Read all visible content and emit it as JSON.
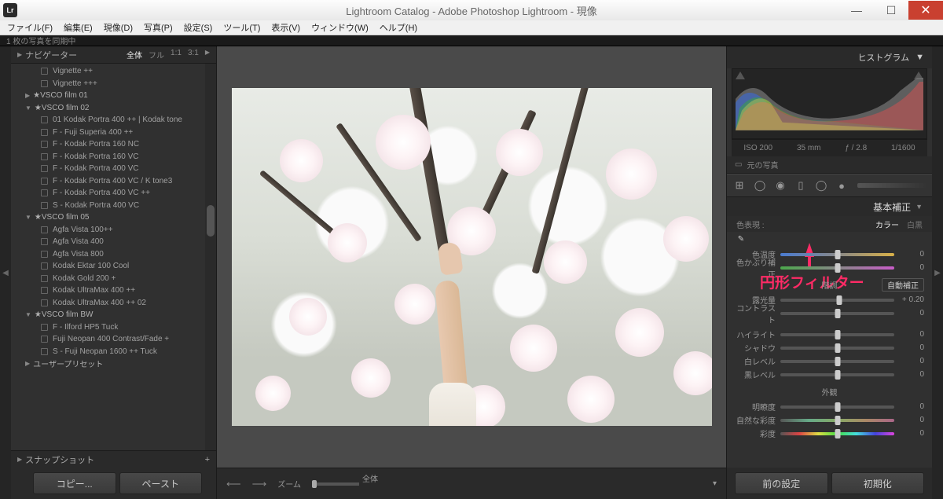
{
  "window": {
    "title": "Lightroom Catalog - Adobe Photoshop Lightroom - 現像",
    "icon_text": "Lr"
  },
  "menu": [
    "ファイル(F)",
    "編集(E)",
    "現像(D)",
    "写真(P)",
    "設定(S)",
    "ツール(T)",
    "表示(V)",
    "ウィンドウ(W)",
    "ヘルプ(H)"
  ],
  "sync_status": "1 枚の写真を同期中",
  "navigator": {
    "title": "ナビゲーター",
    "options": [
      "全体",
      "フル",
      "1:1",
      "3:1"
    ],
    "active": "全体"
  },
  "presets": [
    {
      "type": "child",
      "label": "Vignette ++"
    },
    {
      "type": "child",
      "label": "Vignette +++"
    },
    {
      "type": "folder",
      "label": "★VSCO film 01"
    },
    {
      "type": "folder",
      "label": "★VSCO film 02",
      "open": true
    },
    {
      "type": "child",
      "label": "01 Kodak Portra 400 ++ | Kodak tone"
    },
    {
      "type": "child",
      "label": "F - Fuji Superia 400 ++"
    },
    {
      "type": "child",
      "label": "F - Kodak Portra 160 NC"
    },
    {
      "type": "child",
      "label": "F - Kodak Portra 160 VC"
    },
    {
      "type": "child",
      "label": "F - Kodak Portra 400 VC"
    },
    {
      "type": "child",
      "label": "F - Kodak Portra 400 VC / K tone3"
    },
    {
      "type": "child",
      "label": "F - Kodak Portra 400 VC ++"
    },
    {
      "type": "child",
      "label": "S - Kodak Portra 400 VC"
    },
    {
      "type": "folder",
      "label": "★VSCO film 05",
      "open": true
    },
    {
      "type": "child",
      "label": "Agfa Vista 100++"
    },
    {
      "type": "child",
      "label": "Agfa Vista 400"
    },
    {
      "type": "child",
      "label": "Agfa Vista 800"
    },
    {
      "type": "child",
      "label": "Kodak Ektar 100 Cool"
    },
    {
      "type": "child",
      "label": "Kodak Gold 200 +"
    },
    {
      "type": "child",
      "label": "Kodak UltraMax 400 ++"
    },
    {
      "type": "child",
      "label": "Kodak UltraMax 400 ++ 02"
    },
    {
      "type": "folder",
      "label": "★VSCO film BW",
      "open": true
    },
    {
      "type": "child",
      "label": "F - Ilford HP5 Tuck"
    },
    {
      "type": "child",
      "label": "Fuji Neopan 400 Contrast/Fade +"
    },
    {
      "type": "child",
      "label": "S - Fuji Neopan 1600 ++ Tuck"
    },
    {
      "type": "folder",
      "label": "ユーザープリセット"
    }
  ],
  "snapshot": "スナップショット",
  "left_buttons": {
    "copy": "コピー...",
    "paste": "ペースト"
  },
  "center": {
    "zoom_label": "ズーム",
    "zoom_value": "全体"
  },
  "right": {
    "histogram_title": "ヒストグラム",
    "exif": {
      "iso": "ISO 200",
      "focal": "35 mm",
      "aperture": "ƒ / 2.8",
      "shutter": "1/1600"
    },
    "original": "元の写真",
    "basic_title": "基本補正",
    "treatment_label": "色表現 :",
    "treatment_color": "カラー",
    "treatment_bw": "白黒",
    "annotation": "円形フィルター",
    "tone_header": "階調",
    "auto_tone": "自動補正",
    "presence_header": "外観",
    "sliders": {
      "temp": {
        "label": "色温度",
        "value": "0",
        "pos": 50
      },
      "tint": {
        "label": "色かぶり補正",
        "value": "0",
        "pos": 50
      },
      "exposure": {
        "label": "露光量",
        "value": "+ 0.20",
        "pos": 52
      },
      "contrast": {
        "label": "コントラスト",
        "value": "0",
        "pos": 50
      },
      "highlights": {
        "label": "ハイライト",
        "value": "0",
        "pos": 50
      },
      "shadows": {
        "label": "シャドウ",
        "value": "0",
        "pos": 50
      },
      "whites": {
        "label": "白レベル",
        "value": "0",
        "pos": 50
      },
      "blacks": {
        "label": "黒レベル",
        "value": "0",
        "pos": 50
      },
      "clarity": {
        "label": "明瞭度",
        "value": "0",
        "pos": 50
      },
      "vibrance": {
        "label": "自然な彩度",
        "value": "0",
        "pos": 50
      },
      "saturation": {
        "label": "彩度",
        "value": "0",
        "pos": 50
      }
    },
    "bottom_buttons": {
      "prev": "前の設定",
      "reset": "初期化"
    }
  }
}
